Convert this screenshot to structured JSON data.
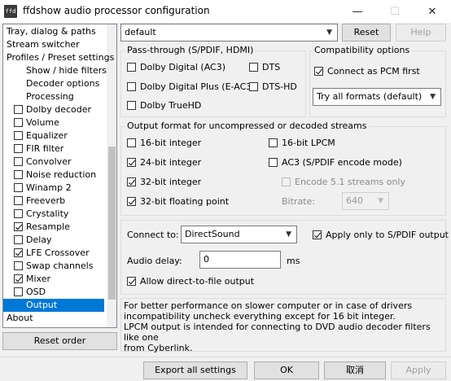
{
  "window": {
    "icon_text": "ffd",
    "title": "ffdshow audio processor configuration",
    "minimize": "—",
    "maximize": "☐",
    "close": "✕"
  },
  "tree": [
    {
      "label": "Tray, dialog & paths",
      "indent": 0,
      "checkbox": null
    },
    {
      "label": "Stream switcher",
      "indent": 0,
      "checkbox": null
    },
    {
      "label": "Profiles / Preset settings",
      "indent": 0,
      "checkbox": null
    },
    {
      "label": "Show / hide filters",
      "indent": 1,
      "checkbox": null
    },
    {
      "label": "Decoder options",
      "indent": 1,
      "checkbox": null
    },
    {
      "label": "Processing",
      "indent": 1,
      "checkbox": null
    },
    {
      "label": "Dolby decoder",
      "indent": 1,
      "checkbox": false
    },
    {
      "label": "Volume",
      "indent": 1,
      "checkbox": false
    },
    {
      "label": "Equalizer",
      "indent": 1,
      "checkbox": false
    },
    {
      "label": "FIR filter",
      "indent": 1,
      "checkbox": false
    },
    {
      "label": "Convolver",
      "indent": 1,
      "checkbox": false
    },
    {
      "label": "Noise reduction",
      "indent": 1,
      "checkbox": false
    },
    {
      "label": "Winamp 2",
      "indent": 1,
      "checkbox": false
    },
    {
      "label": "Freeverb",
      "indent": 1,
      "checkbox": false
    },
    {
      "label": "Crystality",
      "indent": 1,
      "checkbox": false
    },
    {
      "label": "Resample",
      "indent": 1,
      "checkbox": true
    },
    {
      "label": "Delay",
      "indent": 1,
      "checkbox": false
    },
    {
      "label": "LFE Crossover",
      "indent": 1,
      "checkbox": true
    },
    {
      "label": "Swap channels",
      "indent": 1,
      "checkbox": false
    },
    {
      "label": "Mixer",
      "indent": 1,
      "checkbox": true
    },
    {
      "label": "OSD",
      "indent": 1,
      "checkbox": false
    },
    {
      "label": "Output",
      "indent": 1,
      "checkbox": null,
      "selected": true
    },
    {
      "label": "About",
      "indent": 0,
      "checkbox": null
    }
  ],
  "buttons": {
    "reset_order": "Reset order",
    "reset": "Reset",
    "help": "Help",
    "export_all": "Export all settings",
    "ok": "OK",
    "cancel": "取消",
    "apply": "Apply"
  },
  "preset": {
    "value": "default"
  },
  "passthrough": {
    "title": "Pass-through (S/PDIF, HDMI)",
    "dolby_digital": {
      "label": "Dolby Digital (AC3)",
      "checked": false
    },
    "dts": {
      "label": "DTS",
      "checked": false
    },
    "dolby_digital_plus": {
      "label": "Dolby Digital Plus (E-AC3)",
      "checked": false
    },
    "dts_hd": {
      "label": "DTS-HD",
      "checked": false
    },
    "dolby_truehd": {
      "label": "Dolby TrueHD",
      "checked": false
    }
  },
  "compat": {
    "title": "Compatibility options",
    "connect_pcm": {
      "label": "Connect as PCM first",
      "checked": true
    },
    "formats": "Try all formats (default)"
  },
  "output_format": {
    "title": "Output format for uncompressed or decoded streams",
    "bit16": {
      "label": "16-bit integer",
      "checked": false
    },
    "lpcm16": {
      "label": "16-bit LPCM",
      "checked": false
    },
    "bit24": {
      "label": "24-bit integer",
      "checked": true
    },
    "ac3": {
      "label": "AC3 (S/PDIF encode mode)",
      "checked": false
    },
    "bit32": {
      "label": "32-bit integer",
      "checked": true
    },
    "encode51": {
      "label": "Encode 5.1 streams only",
      "checked": false
    },
    "float32": {
      "label": "32-bit floating point",
      "checked": true
    },
    "bitrate_label": "Bitrate:",
    "bitrate_value": "640"
  },
  "connection": {
    "connect_label": "Connect to:",
    "connect_value": "DirectSound",
    "spdif_only": {
      "label": "Apply only to S/PDIF output",
      "checked": true
    },
    "delay_label": "Audio delay:",
    "delay_value": "0",
    "delay_unit": "ms",
    "direct_file": {
      "label": "Allow direct-to-file output",
      "checked": true
    }
  },
  "info": {
    "line1": "For better performance on slower computer or in case of drivers",
    "line2": "incompatibility uncheck everything except for 16 bit integer.",
    "line3": "LPCM output is intended for connecting to DVD audio decoder filters like one",
    "line4": "from Cyberlink."
  }
}
